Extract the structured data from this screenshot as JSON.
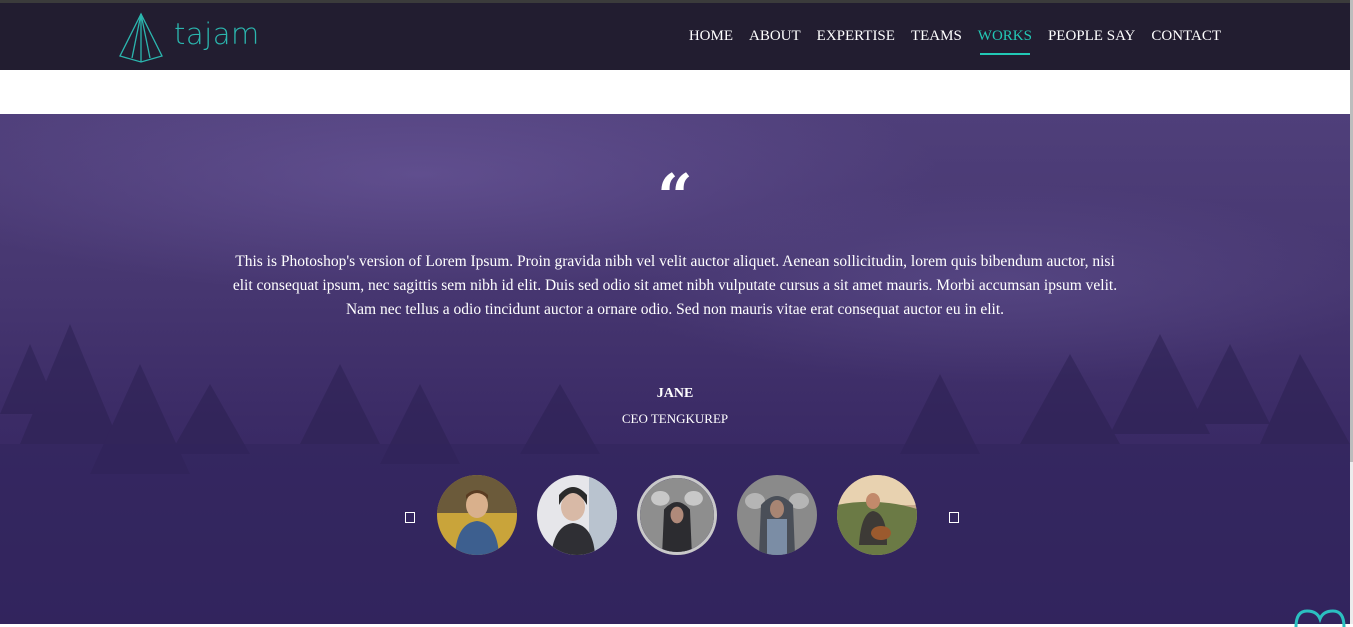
{
  "brand": {
    "name": "tajam",
    "color": "#2bb6ae"
  },
  "nav": {
    "items": [
      {
        "label": "HOME"
      },
      {
        "label": "ABOUT"
      },
      {
        "label": "EXPERTISE"
      },
      {
        "label": "TEAMS"
      },
      {
        "label": "WORKS",
        "active": true
      },
      {
        "label": "PEOPLE SAY"
      },
      {
        "label": "CONTACT"
      }
    ],
    "active_color": "#22c8b5"
  },
  "testimonial": {
    "quote_mark": "“",
    "text": "This is Photoshop's version of Lorem Ipsum. Proin gravida nibh vel velit auctor aliquet. Aenean sollicitudin, lorem quis bibendum auctor, nisi elit consequat ipsum, nec sagittis sem nibh id elit. Duis sed odio sit amet nibh vulputate cursus a sit amet mauris. Morbi accumsan ipsum velit. Nam nec tellus a odio tincidunt auctor a ornare odio. Sed non mauris vitae erat consequat auctor eu in elit.",
    "author": "JANE",
    "role": "CEO TENGKUREP"
  },
  "carousel": {
    "prev_icon": "square-arrow-left-icon",
    "next_icon": "square-arrow-right-icon",
    "avatars": [
      {
        "name": "man-with-glasses-avatar"
      },
      {
        "name": "woman-on-phone-avatar"
      },
      {
        "name": "hooded-person-avatar",
        "active": true
      },
      {
        "name": "hooded-person-grey-avatar"
      },
      {
        "name": "guitar-player-avatar"
      }
    ]
  }
}
